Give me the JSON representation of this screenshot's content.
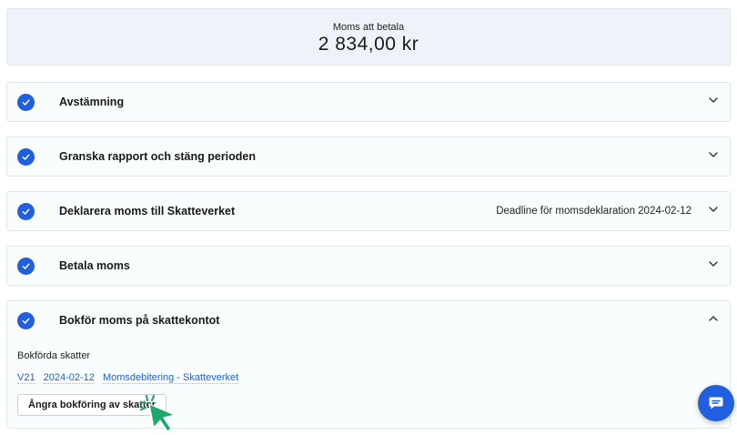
{
  "summary": {
    "label": "Moms att betala",
    "amount": "2 834,00 kr"
  },
  "steps": [
    {
      "title": "Avstämning",
      "done": true
    },
    {
      "title": "Granska rapport och stäng perioden",
      "done": true
    },
    {
      "title": "Deklarera moms till Skatteverket",
      "done": true,
      "deadline": "Deadline för momsdeklaration 2024-02-12"
    },
    {
      "title": "Betala moms",
      "done": true
    },
    {
      "title": "Bokför moms på skattekontot",
      "done": true,
      "expanded": true
    }
  ],
  "booked": {
    "label": "Bokförda skatter",
    "entry": {
      "voucher": "V21",
      "date": "2024-02-12",
      "description": "Momsdebitering - Skatteverket"
    },
    "undo_label": "Ångra bokföring av skatter"
  },
  "icons": {
    "step": "check-icon",
    "collapsed": "chevron-down-icon",
    "expanded": "chevron-up-icon",
    "chat": "chat-icon",
    "cursor": "cursor-click-icon"
  },
  "colors": {
    "accent": "#1f5fe0",
    "cursor": "#1faa6b",
    "summary_bg": "#eef3fa"
  }
}
